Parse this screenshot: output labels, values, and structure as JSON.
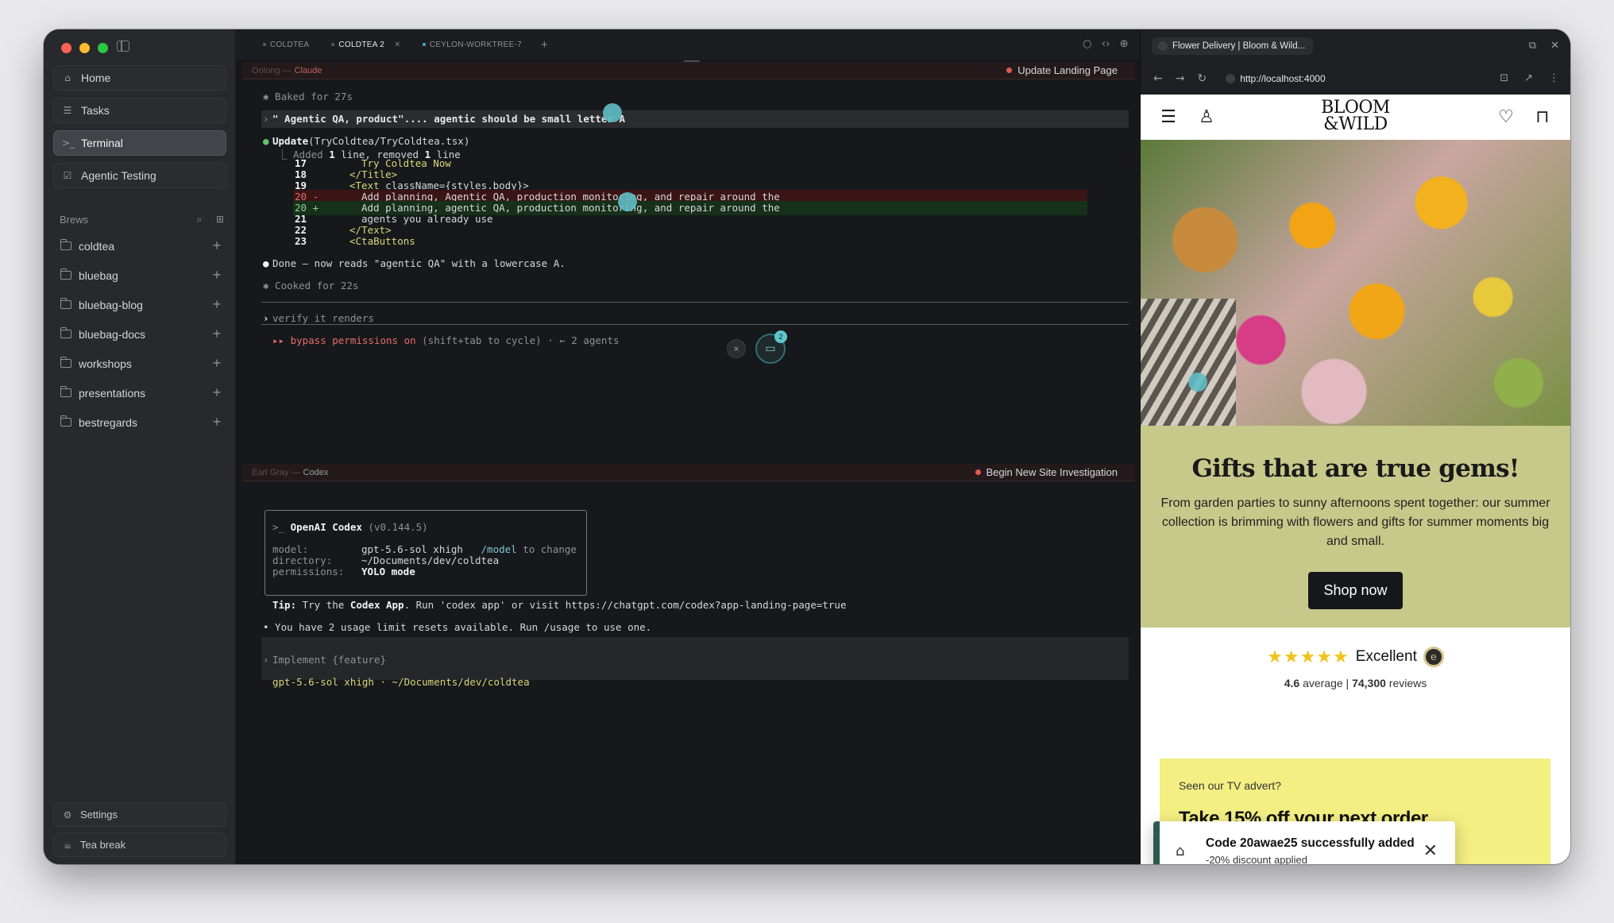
{
  "sidebar": {
    "nav": [
      {
        "label": "Home",
        "icon": "home-icon",
        "glyph": "⌂"
      },
      {
        "label": "Tasks",
        "icon": "tasks-icon",
        "glyph": "☰"
      },
      {
        "label": "Terminal",
        "icon": "terminal-icon",
        "glyph": ">_"
      },
      {
        "label": "Agentic Testing",
        "icon": "checkbox-icon",
        "glyph": "☑"
      }
    ],
    "brews_title": "Brews",
    "brews": [
      "coldtea",
      "bluebag",
      "bluebag-blog",
      "bluebag-docs",
      "workshops",
      "presentations",
      "bestregards"
    ],
    "settings_label": "Settings",
    "tea_break_label": "Tea break"
  },
  "tabs": [
    {
      "label": "COLDTEA",
      "active": false
    },
    {
      "label": "COLDTEA 2",
      "active": true
    },
    {
      "label": "CEYLON-WORKTREE-7",
      "active": false
    }
  ],
  "pane_top": {
    "session": "Oolong —",
    "agent": "Claude",
    "task": "Update Landing Page",
    "lines": {
      "baked": "✱ Baked for 27s",
      "user_msg": "\" Agentic QA, product\".... agentic should be small letter A",
      "update_head": "Update",
      "update_file": "(TryColdtea/TryColdtea.tsx)",
      "update_summary_a": "⎿ Added ",
      "update_n1": "1",
      "update_summary_b": " line, removed ",
      "update_n2": "1",
      "update_summary_c": " line",
      "l17_no": "17",
      "l17": "Try Coldtea Now",
      "l18_no": "18",
      "l18": "</Title>",
      "l19_no": "19",
      "l19_a": "<Text",
      "l19_b": " className={styles.body}>",
      "l20d_no": "20 -",
      "l20d": "Add planning, Agentic QA, production monitoring, and repair around the",
      "l20a_no": "20 +",
      "l20a": "Add planning, agentic QA, production monitoring, and repair around the",
      "l21_no": "21",
      "l21": "agents you already use",
      "l22_no": "22",
      "l22": "</Text>",
      "l23_no": "23",
      "l23": "<CtaButtons",
      "done": "Done — now reads \"agentic QA\" with a lowercase A.",
      "cooked": "✱ Cooked for 22s",
      "input": "verify it renders",
      "bypass_a": "▸▸ bypass permissions on",
      "bypass_b": " (shift+tab to cycle) · ← 2 agents"
    },
    "badge_count": "2"
  },
  "pane_bottom": {
    "session": "Earl Gray —",
    "agent": "Codex",
    "task": "Begin New Site Investigation",
    "codex_title_a": ">_ ",
    "codex_title_b": "OpenAI Codex",
    "codex_version": " (v0.144.5)",
    "model_label": "model:",
    "model_value": "gpt-5.6-sol xhigh",
    "model_hint_a": "/model",
    "model_hint_b": " to change",
    "dir_label": "directory:",
    "dir_value": "~/Documents/dev/coldtea",
    "perm_label": "permissions:",
    "perm_value": "YOLO mode",
    "tip_a": "Tip:",
    "tip_b": " Try the ",
    "tip_c": "Codex App",
    "tip_d": ". Run 'codex app' or visit https://chatgpt.com/codex?app-landing-page=true",
    "usage": "• You have 2 usage limit resets available. Run /usage to use one.",
    "input": "Implement {feature}",
    "status": "gpt-5.6-sol xhigh · ~/Documents/dev/coldtea"
  },
  "browser": {
    "tab_title": "Flower Delivery | Bloom & Wild...",
    "url": "http://localhost:4000",
    "logo_line1": "BLOOM",
    "logo_line2": "&WILD",
    "promo_title": "Gifts that are true gems!",
    "promo_body": "From garden parties to sunny afternoons spent together: our summer collection is brimming with flowers and gifts for summer moments big and small.",
    "shop_label": "Shop now",
    "stars": "★★★★★",
    "rating_label": "Excellent",
    "rating_avg": "4.6",
    "rating_avg_suffix": " average | ",
    "rating_count": "74,300",
    "rating_count_suffix": " reviews",
    "tv_small": "Seen our TV advert?",
    "tv_big": "Take 15% off your next order",
    "toast_title": "Code 20awae25 successfully added",
    "toast_sub": "-20% discount applied"
  },
  "colors": {
    "accent_teal": "#5fbdc4",
    "promo_bg": "#c6c989",
    "tv_bg": "#f3ef83",
    "toast_border": "#2d5a4e"
  }
}
